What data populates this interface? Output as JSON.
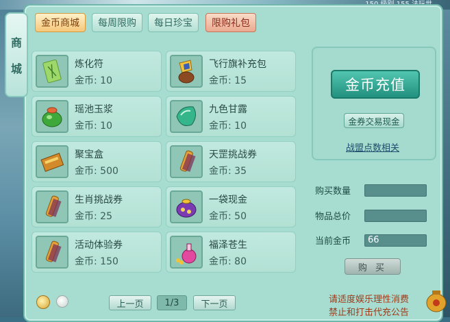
{
  "window": {
    "top_text": "150 级别 155 法玩世"
  },
  "side_tab": {
    "chars": [
      "商",
      "城"
    ]
  },
  "tabs": [
    {
      "label": "金币商城",
      "state": "active"
    },
    {
      "label": "每周限购",
      "state": "normal"
    },
    {
      "label": "每日珍宝",
      "state": "normal"
    },
    {
      "label": "限购礼包",
      "state": "red"
    }
  ],
  "items": [
    {
      "name": "炼化符",
      "price": "金币: 10",
      "icon": "talisman-icon"
    },
    {
      "name": "飞行旗补充包",
      "price": "金币: 15",
      "icon": "flag-pack-icon"
    },
    {
      "name": "瑶池玉浆",
      "price": "金币: 10",
      "icon": "jade-potion-icon"
    },
    {
      "name": "九色甘露",
      "price": "金币: 10",
      "icon": "dew-crystal-icon"
    },
    {
      "name": "聚宝盒",
      "price": "金币: 500",
      "icon": "treasure-box-icon"
    },
    {
      "name": "天罡挑战券",
      "price": "金币: 35",
      "icon": "scroll-icon"
    },
    {
      "name": "生肖挑战券",
      "price": "金币: 25",
      "icon": "scroll-icon"
    },
    {
      "name": "一袋现金",
      "price": "金币: 50",
      "icon": "money-bag-icon"
    },
    {
      "name": "活动体验券",
      "price": "金币: 150",
      "icon": "scroll-icon"
    },
    {
      "name": "福泽苍生",
      "price": "金币: 80",
      "icon": "blessing-bottle-icon"
    }
  ],
  "side_panel": {
    "recharge_label": "金币充值",
    "exchange_label": "金券交易现金",
    "guild_link": "战盟点数相关"
  },
  "purchase": {
    "quantity_label": "购买数量",
    "quantity_value": "",
    "total_label": "物品总价",
    "total_value": "",
    "current_label": "当前金币",
    "current_value": "66",
    "buy_label": "购 买"
  },
  "pager": {
    "prev": "上一页",
    "page": "1/3",
    "next": "下一页"
  },
  "notice": {
    "line1": "请适度娱乐理性消费",
    "line2": "禁止和打击代充公告"
  }
}
